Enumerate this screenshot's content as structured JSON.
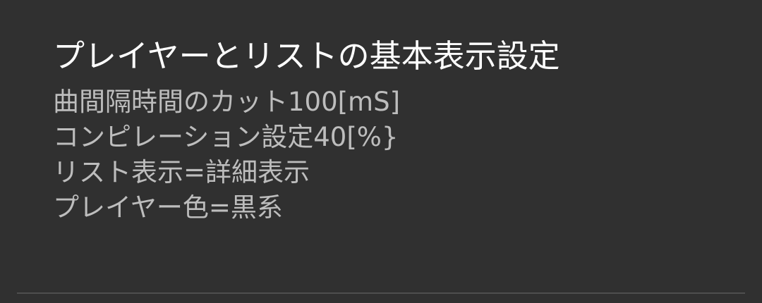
{
  "setting": {
    "title": "プレイヤーとリストの基本表示設定",
    "summary": [
      "曲間隔時間のカット100[mS]",
      "コンピレーション設定40[%}",
      "リスト表示=詳細表示",
      "プレイヤー色=黒系"
    ]
  },
  "colors": {
    "background": "#303030",
    "title": "#ffffff",
    "summary": "#bdbdbd",
    "divider": "#4e4e4e"
  }
}
